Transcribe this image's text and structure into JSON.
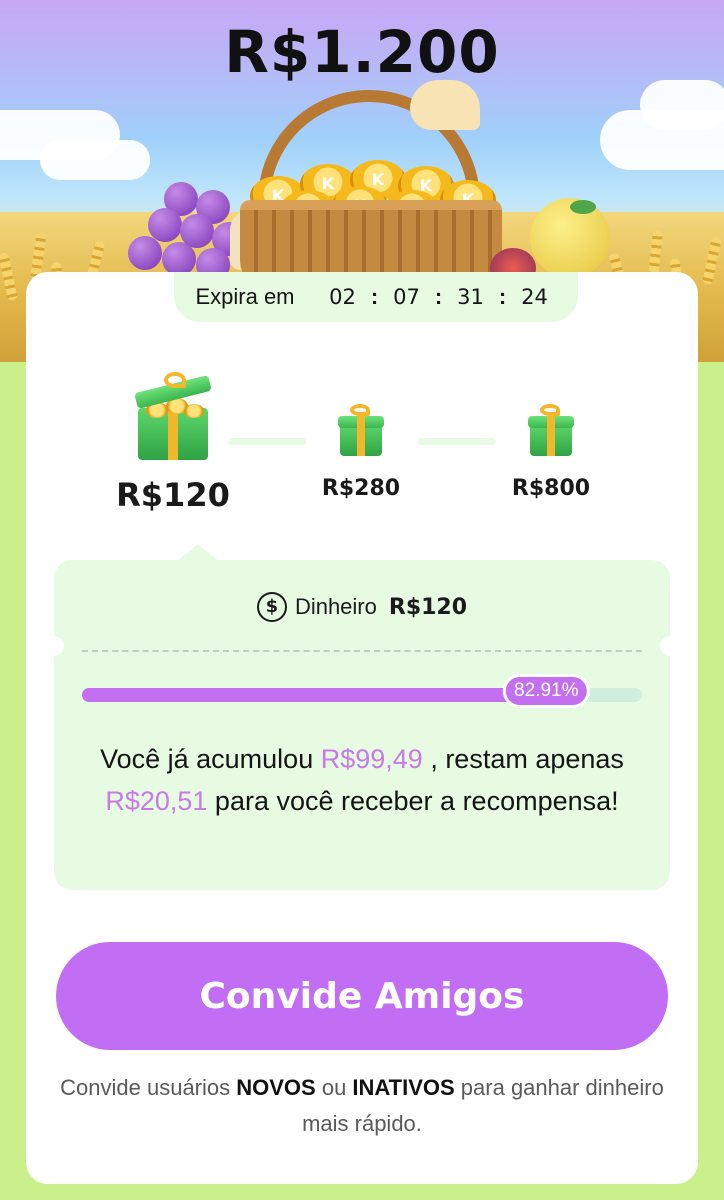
{
  "hero": {
    "title": "R$1.200"
  },
  "timer": {
    "label": "Expira em",
    "days": "02",
    "hours": "07",
    "minutes": "31",
    "seconds": "24",
    "separator": ":"
  },
  "milestones": [
    {
      "amount": "R$120",
      "active": true
    },
    {
      "amount": "R$280",
      "active": false
    },
    {
      "amount": "R$800",
      "active": false
    }
  ],
  "reward": {
    "icon": "dollar-circle-icon",
    "icon_glyph": "$",
    "type_label": "Dinheiro",
    "amount": "R$120"
  },
  "progress": {
    "percent": 82.91,
    "label": "82.91%"
  },
  "message": {
    "part1": "Você já acumulou ",
    "accumulated": "R$99,49",
    "part2": " , restam apenas ",
    "remaining": "R$20,51",
    "part3": " para você receber a recompensa!"
  },
  "cta": {
    "label": "Convide Amigos"
  },
  "hint": {
    "part1": "Convide usuários ",
    "bold1": "NOVOS",
    "part2": " ou ",
    "bold2": "INATIVOS",
    "part3": " para ganhar dinheiro mais rápido."
  },
  "colors": {
    "accent": "#c26ef4",
    "highlight": "#c77ae8",
    "panel": "#e7fbe3",
    "page_bg": "#c9f08a"
  }
}
